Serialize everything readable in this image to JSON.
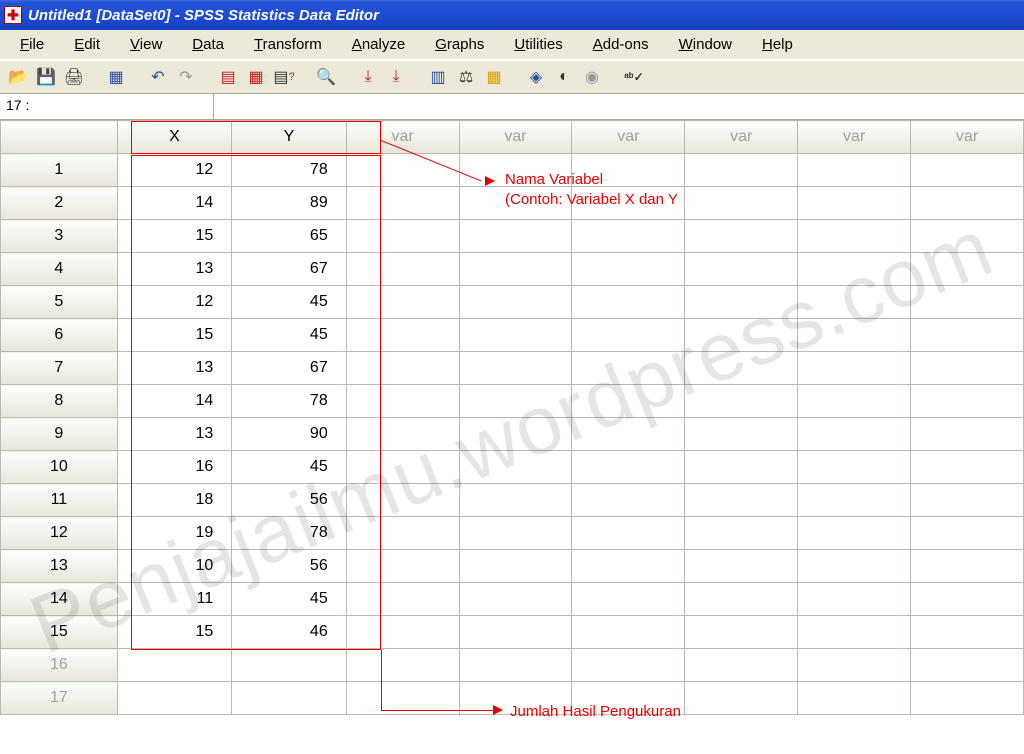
{
  "title": "Untitled1 [DataSet0] - SPSS Statistics Data Editor",
  "menus": [
    "File",
    "Edit",
    "View",
    "Data",
    "Transform",
    "Analyze",
    "Graphs",
    "Utilities",
    "Add-ons",
    "Window",
    "Help"
  ],
  "cell_addr": "17 :",
  "cell_value": "",
  "columns": {
    "visible": [
      "X",
      "Y"
    ],
    "empty_label": "var",
    "empty_count": 6
  },
  "row_headers": {
    "filled": 15,
    "dimmed": [
      16,
      17
    ]
  },
  "rows": [
    {
      "X": 12,
      "Y": 78
    },
    {
      "X": 14,
      "Y": 89
    },
    {
      "X": 15,
      "Y": 65
    },
    {
      "X": 13,
      "Y": 67
    },
    {
      "X": 12,
      "Y": 45
    },
    {
      "X": 15,
      "Y": 45
    },
    {
      "X": 13,
      "Y": 67
    },
    {
      "X": 14,
      "Y": 78
    },
    {
      "X": 13,
      "Y": 90
    },
    {
      "X": 16,
      "Y": 45
    },
    {
      "X": 18,
      "Y": 56
    },
    {
      "X": 19,
      "Y": 78
    },
    {
      "X": 10,
      "Y": 56
    },
    {
      "X": 11,
      "Y": 45
    },
    {
      "X": 15,
      "Y": 46
    }
  ],
  "toolbar_icons": [
    "open",
    "save",
    "print",
    "recent",
    "undo",
    "redo",
    "goto-case",
    "insert-var",
    "dialog-recall",
    "find",
    "insert-case",
    "split",
    "weight",
    "select",
    "value-labels",
    "use-sets",
    "show-all",
    "spell"
  ],
  "annotations": {
    "a1_line1": "Nama Variabel",
    "a1_line2": "(Contoh: Variabel X dan Y",
    "a2": "Jumlah Hasil Pengukuran"
  },
  "watermark": "Penjajailmu.wordpress.com"
}
